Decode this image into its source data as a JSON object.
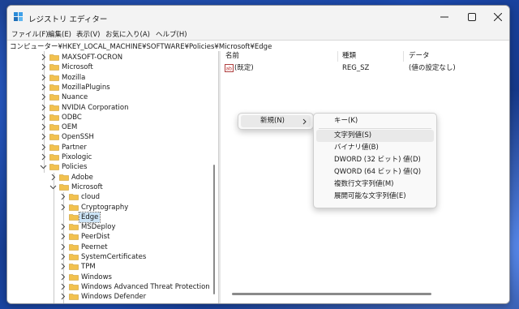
{
  "window": {
    "title": "レジストリ エディター"
  },
  "menubar": {
    "items": [
      "ファイル(F)",
      "編集(E)",
      "表示(V)",
      "お気に入り(A)",
      "ヘルプ(H)"
    ]
  },
  "address": {
    "path": "コンピューター¥HKEY_LOCAL_MACHINE¥SOFTWARE¥Policies¥Microsoft¥Edge"
  },
  "tree": {
    "items": [
      {
        "label": "MAXSOFT-OCRON",
        "level": 1,
        "expanded": false
      },
      {
        "label": "Microsoft",
        "level": 1,
        "expanded": false
      },
      {
        "label": "Mozilla",
        "level": 1,
        "expanded": false
      },
      {
        "label": "MozillaPlugins",
        "level": 1,
        "expanded": false
      },
      {
        "label": "Nuance",
        "level": 1,
        "expanded": false
      },
      {
        "label": "NVIDIA Corporation",
        "level": 1,
        "expanded": false
      },
      {
        "label": "ODBC",
        "level": 1,
        "expanded": false
      },
      {
        "label": "OEM",
        "level": 1,
        "expanded": false
      },
      {
        "label": "OpenSSH",
        "level": 1,
        "expanded": false
      },
      {
        "label": "Partner",
        "level": 1,
        "expanded": false
      },
      {
        "label": "Pixologic",
        "level": 1,
        "expanded": false
      },
      {
        "label": "Policies",
        "level": 1,
        "expanded": true
      },
      {
        "label": "Adobe",
        "level": 2,
        "expanded": false
      },
      {
        "label": "Microsoft",
        "level": 2,
        "expanded": true
      },
      {
        "label": "cloud",
        "level": 3,
        "expanded": false
      },
      {
        "label": "Cryptography",
        "level": 3,
        "expanded": false
      },
      {
        "label": "Edge",
        "level": 3,
        "expanded": false,
        "selected": true,
        "nochev": true
      },
      {
        "label": "MSDeploy",
        "level": 3,
        "expanded": false
      },
      {
        "label": "PeerDist",
        "level": 3,
        "expanded": false
      },
      {
        "label": "Peernet",
        "level": 3,
        "expanded": false
      },
      {
        "label": "SystemCertificates",
        "level": 3,
        "expanded": false
      },
      {
        "label": "TPM",
        "level": 3,
        "expanded": false
      },
      {
        "label": "Windows",
        "level": 3,
        "expanded": false
      },
      {
        "label": "Windows Advanced Threat Protection",
        "level": 3,
        "expanded": false
      },
      {
        "label": "Windows Defender",
        "level": 3,
        "expanded": false
      }
    ]
  },
  "list": {
    "columns": [
      "名前",
      "種類",
      "データ"
    ],
    "rows": [
      {
        "name": "(既定)",
        "type": "REG_SZ",
        "data": "(値の設定なし)",
        "icon": "string-value-icon"
      }
    ]
  },
  "context_menu": {
    "new_label": "新規(N)",
    "submenu": [
      "キー(K)",
      "文字列値(S)",
      "バイナリ値(B)",
      "DWORD (32 ビット) 値(D)",
      "QWORD (64 ビット) 値(Q)",
      "複数行文字列値(M)",
      "展開可能な文字列値(E)"
    ],
    "highlighted_index": 1
  },
  "colors": {
    "folder": "#f2c14e",
    "selection": "#cce4f7",
    "accent": "#0067c0"
  }
}
